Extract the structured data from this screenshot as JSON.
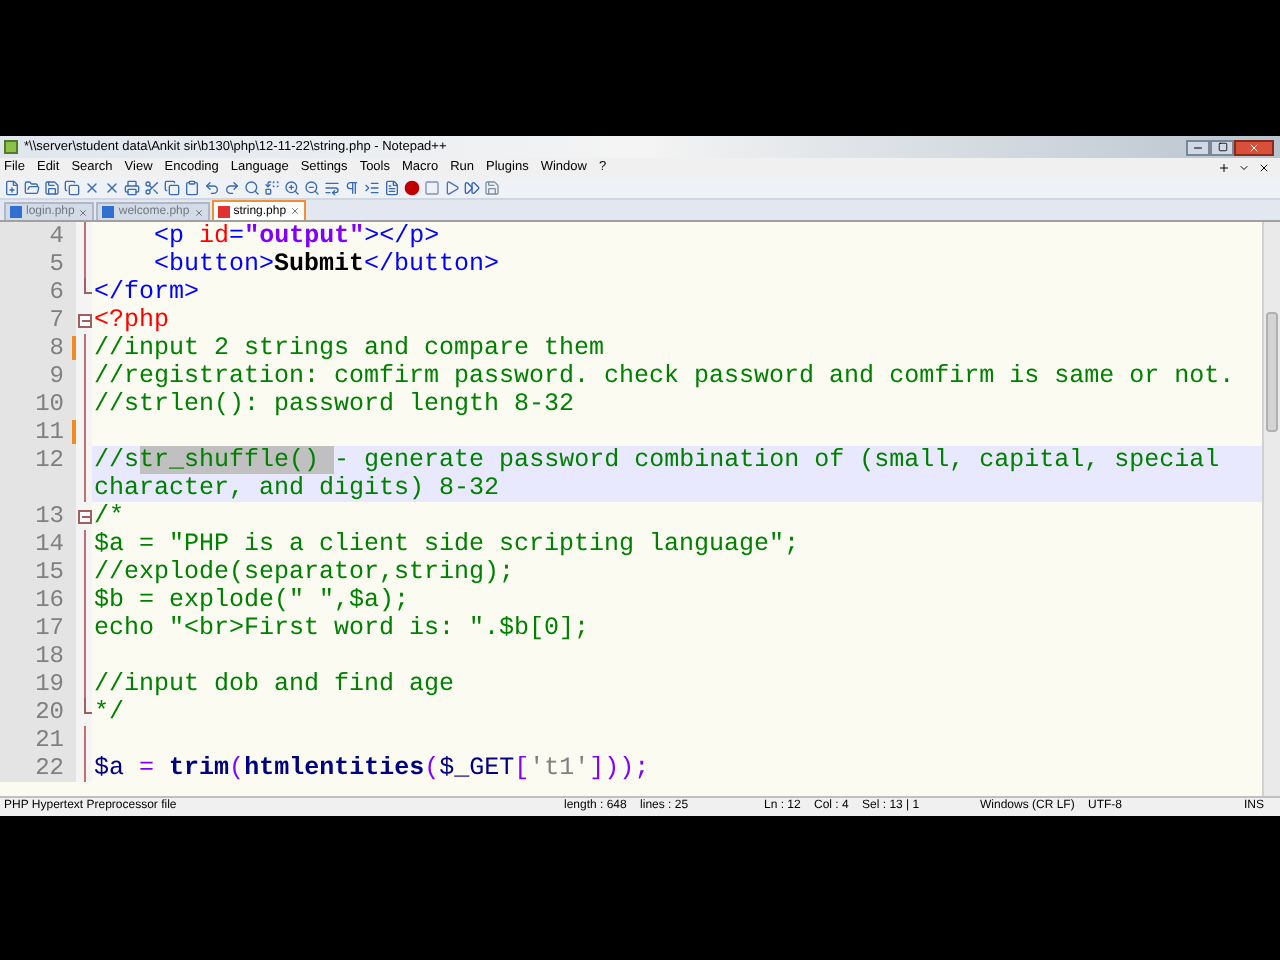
{
  "window": {
    "title": "*\\\\server\\student data\\Ankit sir\\b130\\php\\12-11-22\\string.php - Notepad++"
  },
  "menu": [
    "File",
    "Edit",
    "Search",
    "View",
    "Encoding",
    "Language",
    "Settings",
    "Tools",
    "Macro",
    "Run",
    "Plugins",
    "Window",
    "?"
  ],
  "tabs": [
    {
      "label": "login.php",
      "selected": false,
      "modified": false
    },
    {
      "label": "welcome.php",
      "selected": false,
      "modified": false
    },
    {
      "label": "string.php",
      "selected": true,
      "modified": true
    }
  ],
  "editor": {
    "lines": [
      {
        "no": "4",
        "fold_start": false,
        "fold_end": false,
        "changed": false,
        "current": false,
        "tokens": [
          {
            "kind": "tag",
            "t": "    <p "
          },
          {
            "kind": "attr",
            "t": "id"
          },
          {
            "kind": "tag",
            "t": "="
          },
          {
            "kind": "val",
            "t": "\"output\""
          },
          {
            "kind": "tag",
            "t": "></p>"
          }
        ]
      },
      {
        "no": "5",
        "fold_start": false,
        "fold_end": false,
        "changed": false,
        "current": false,
        "tokens": [
          {
            "kind": "tag",
            "t": "    <button>"
          },
          {
            "kind": "bold",
            "t": "Submit"
          },
          {
            "kind": "tag",
            "t": "</button>"
          }
        ]
      },
      {
        "no": "6",
        "fold_start": false,
        "fold_end": true,
        "changed": false,
        "current": false,
        "tokens": [
          {
            "kind": "tag",
            "t": "</form>"
          }
        ]
      },
      {
        "no": "7",
        "fold_start": true,
        "fold_end": false,
        "changed": false,
        "current": false,
        "tokens": [
          {
            "kind": "php",
            "t": "<?php"
          }
        ]
      },
      {
        "no": "8",
        "fold_start": false,
        "fold_end": false,
        "changed": true,
        "current": false,
        "tokens": [
          {
            "kind": "comment",
            "t": "//input 2 strings and compare them"
          }
        ]
      },
      {
        "no": "9",
        "fold_start": false,
        "fold_end": false,
        "changed": false,
        "current": false,
        "tokens": [
          {
            "kind": "comment",
            "t": "//registration: comfirm password. check password and comfirm is same or not."
          }
        ]
      },
      {
        "no": "10",
        "fold_start": false,
        "fold_end": false,
        "changed": false,
        "current": false,
        "tokens": [
          {
            "kind": "comment",
            "t": "//strlen(): password length 8-32"
          }
        ]
      },
      {
        "no": "11",
        "fold_start": false,
        "fold_end": false,
        "changed": true,
        "current": false
      },
      {
        "no": "12",
        "fold_start": false,
        "fold_end": false,
        "changed": false,
        "current": true,
        "tokens": [
          {
            "kind": "comment",
            "t": "//s",
            "selected": false
          },
          {
            "kind": "comment",
            "t": "tr_shuffle() ",
            "selected": true
          },
          {
            "kind": "comment",
            "t": "- generate password combination of (small, capital, special character, and digits) 8-32",
            "selected": false
          }
        ]
      },
      {
        "no": "13",
        "fold_start": true,
        "fold_end": false,
        "changed": false,
        "current": false,
        "tokens": [
          {
            "kind": "comment",
            "t": "/*"
          }
        ]
      },
      {
        "no": "14",
        "fold_start": false,
        "fold_end": false,
        "changed": false,
        "current": false,
        "tokens": [
          {
            "kind": "comment",
            "t": "$a = \"PHP is a client side scripting language\";"
          }
        ]
      },
      {
        "no": "15",
        "fold_start": false,
        "fold_end": false,
        "changed": false,
        "current": false,
        "tokens": [
          {
            "kind": "comment",
            "t": "//explode(separator,string);"
          }
        ]
      },
      {
        "no": "16",
        "fold_start": false,
        "fold_end": false,
        "changed": false,
        "current": false,
        "tokens": [
          {
            "kind": "comment",
            "t": "$b = explode(\" \",$a);"
          }
        ]
      },
      {
        "no": "17",
        "fold_start": false,
        "fold_end": false,
        "changed": false,
        "current": false,
        "tokens": [
          {
            "kind": "comment",
            "t": "echo \"<br>First word is: \".$b[0];"
          }
        ]
      },
      {
        "no": "18",
        "fold_start": false,
        "fold_end": false,
        "changed": false,
        "current": false
      },
      {
        "no": "19",
        "fold_start": false,
        "fold_end": false,
        "changed": false,
        "current": false,
        "tokens": [
          {
            "kind": "comment",
            "t": "//input dob and find age"
          }
        ]
      },
      {
        "no": "20",
        "fold_start": false,
        "fold_end": true,
        "changed": false,
        "current": false,
        "tokens": [
          {
            "kind": "comment",
            "t": "*/"
          }
        ]
      },
      {
        "no": "21",
        "fold_start": false,
        "fold_end": false,
        "changed": false,
        "current": false
      },
      {
        "no": "22",
        "fold_start": false,
        "fold_end": false,
        "changed": false,
        "current": false,
        "tokens": [
          {
            "kind": "var",
            "t": "$a"
          },
          {
            "kind": "op",
            "t": " = "
          },
          {
            "kind": "func",
            "t": "trim"
          },
          {
            "kind": "op",
            "t": "("
          },
          {
            "kind": "func",
            "t": "htmlentities"
          },
          {
            "kind": "op",
            "t": "("
          },
          {
            "kind": "var",
            "t": "$_GET"
          },
          {
            "kind": "op",
            "t": "["
          },
          {
            "kind": "str",
            "t": "'t1'"
          },
          {
            "kind": "op",
            "t": "]));"
          }
        ]
      }
    ]
  },
  "status_bar": {
    "file_type": "PHP Hypertext Preprocessor file",
    "size": "length : 648    lines : 25",
    "position": "Ln : 12    Col : 4    Sel : 13 | 1",
    "eol": "Windows (CR LF)",
    "encoding": "UTF-8",
    "mode": "INS"
  }
}
